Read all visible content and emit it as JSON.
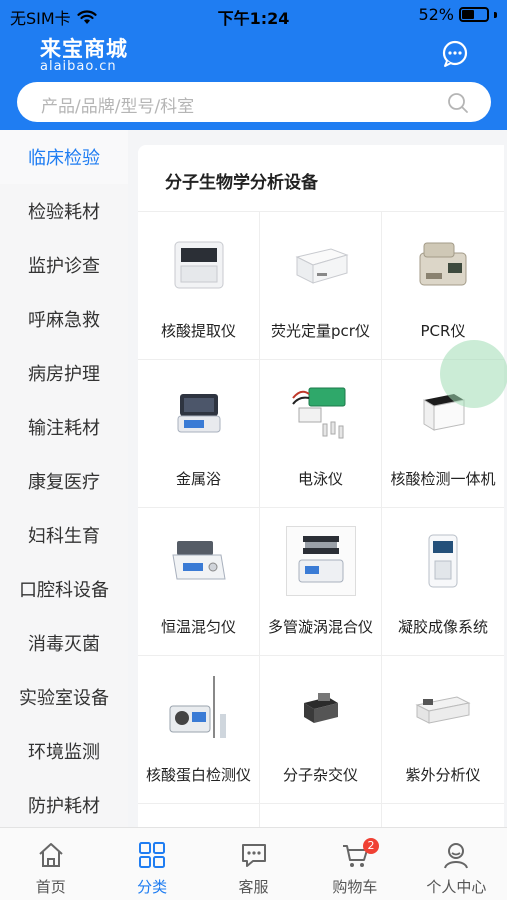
{
  "status": {
    "carrier": "无SIM卡",
    "time": "下午1:24",
    "battery": "52%",
    "battery_level": 0.52
  },
  "header": {
    "logo_zh": "来宝商城",
    "logo_en": "alaibao.cn",
    "search_placeholder": "产品/品牌/型号/科室"
  },
  "sidebar": {
    "items": [
      {
        "label": "临床检验"
      },
      {
        "label": "检验耗材"
      },
      {
        "label": "监护诊查"
      },
      {
        "label": "呼麻急救"
      },
      {
        "label": "病房护理"
      },
      {
        "label": "输注耗材"
      },
      {
        "label": "康复医疗"
      },
      {
        "label": "妇科生育"
      },
      {
        "label": "口腔科设备"
      },
      {
        "label": "消毒灭菌"
      },
      {
        "label": "实验室设备"
      },
      {
        "label": "环境监测"
      },
      {
        "label": "防护耗材"
      }
    ]
  },
  "panel": {
    "title": "分子生物学分析设备",
    "products": [
      {
        "name": "核酸提取仪"
      },
      {
        "name": "荧光定量pcr仪"
      },
      {
        "name": "PCR仪"
      },
      {
        "name": "金属浴"
      },
      {
        "name": "电泳仪"
      },
      {
        "name": "核酸检测一体机"
      },
      {
        "name": "恒温混匀仪"
      },
      {
        "name": "多管漩涡混合仪"
      },
      {
        "name": "凝胶成像系统"
      },
      {
        "name": "核酸蛋白检测仪"
      },
      {
        "name": "分子杂交仪"
      },
      {
        "name": "紫外分析仪"
      }
    ]
  },
  "tabbar": {
    "items": [
      {
        "label": "首页"
      },
      {
        "label": "分类"
      },
      {
        "label": "客服"
      },
      {
        "label": "购物车",
        "badge": "2"
      },
      {
        "label": "个人中心"
      }
    ]
  }
}
